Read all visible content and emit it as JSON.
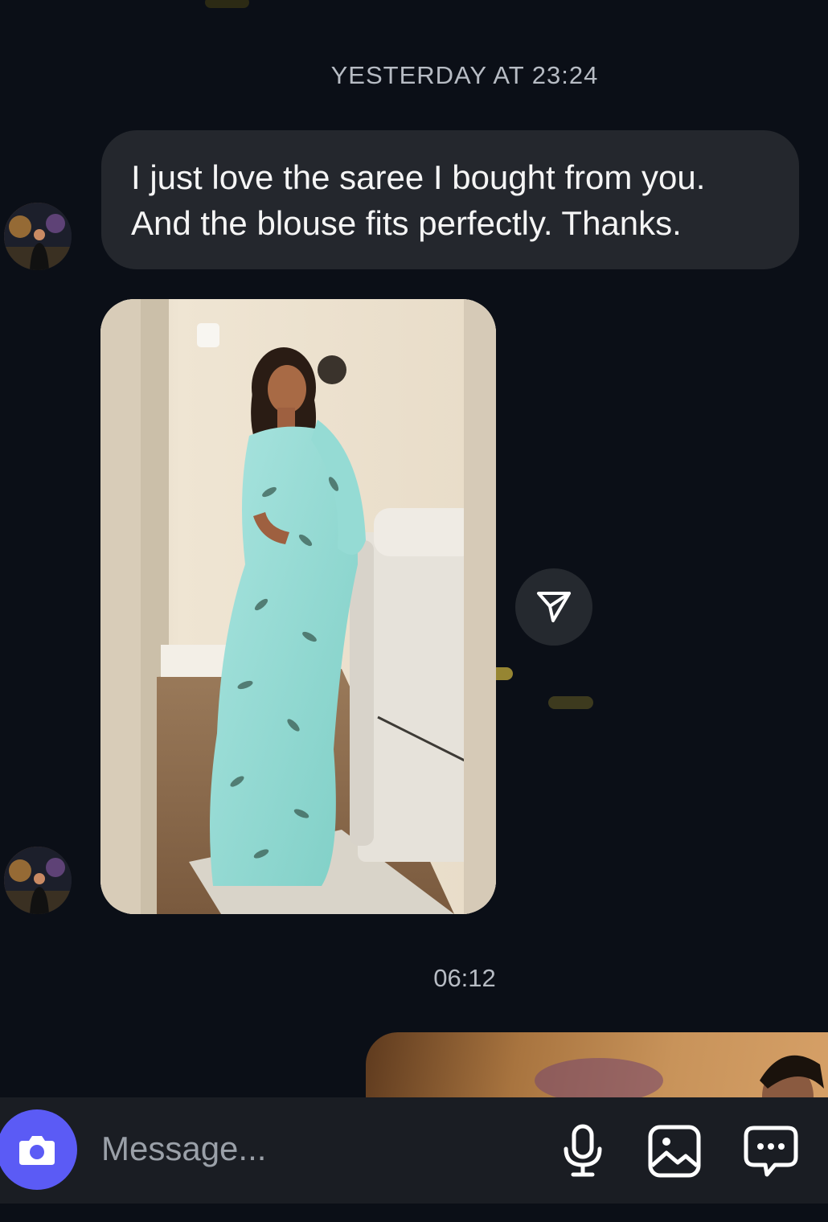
{
  "thread": {
    "timestamp_1": "YESTERDAY AT 23:24",
    "message_1": {
      "line_1": "I just love the saree I bought from you.",
      "line_2": "And the blouse fits perfectly. Thanks."
    },
    "timestamp_2": "06:12"
  },
  "composer": {
    "placeholder": "Message..."
  },
  "icons": {
    "camera": "camera-icon",
    "mic": "microphone-icon",
    "gallery": "image-gallery-icon",
    "sticker": "chat-bubble-icon",
    "share": "paper-plane-icon"
  },
  "colors": {
    "background": "#0b0f17",
    "bubble": "#24272d",
    "accent": "#5b5bf5"
  }
}
